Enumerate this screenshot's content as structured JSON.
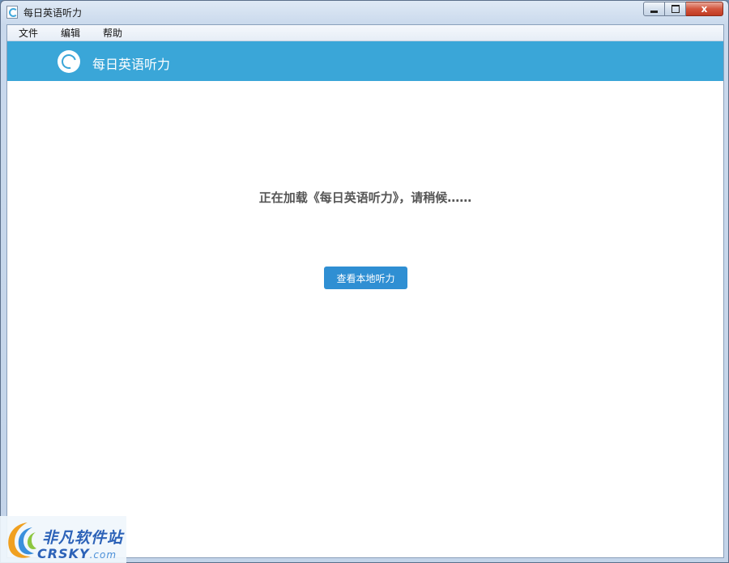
{
  "window": {
    "title": "每日英语听力",
    "controls": {
      "close_label": "x"
    }
  },
  "menu": {
    "items": [
      {
        "label": "文件"
      },
      {
        "label": "编辑"
      },
      {
        "label": "帮助"
      }
    ]
  },
  "header": {
    "title": "每日英语听力",
    "icon": "headphone-logo-icon"
  },
  "main": {
    "loading_text": "正在加载《每日英语听力》，请稍候……",
    "local_button_label": "查看本地听力"
  },
  "watermark": {
    "cn_text": "非凡软件站",
    "en_text": "CRSKY",
    "en_suffix": ".com"
  },
  "colors": {
    "header_bg": "#3aa6d8",
    "button_bg": "#2f8fd3",
    "watermark_text": "#2c62b8"
  }
}
